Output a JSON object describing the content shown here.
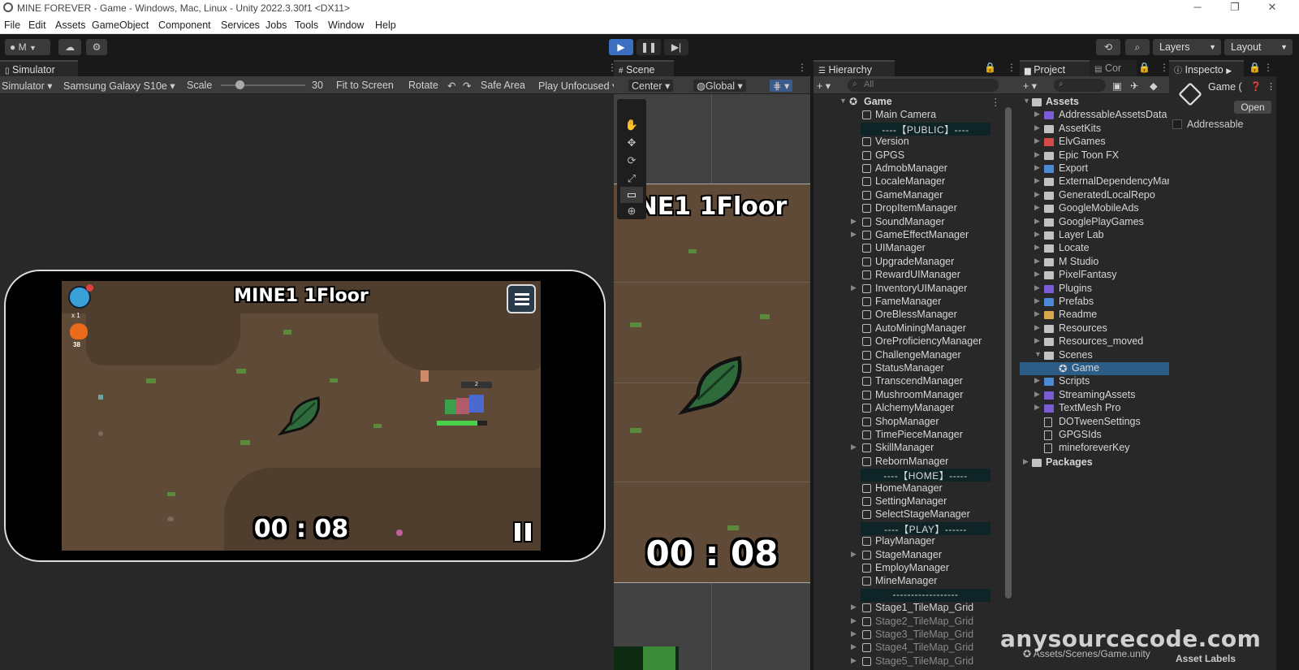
{
  "window": {
    "title": "MINE  FOREVER - Game - Windows, Mac, Linux - Unity 2022.3.30f1 <DX11>",
    "minimize": "─",
    "restore": "❐",
    "close": "✕"
  },
  "menu": [
    "File",
    "Edit",
    "Assets",
    "GameObject",
    "Component",
    "Services",
    "Jobs",
    "Tools",
    "Window",
    "Help"
  ],
  "toolbar": {
    "account_label": "M",
    "layers_label": "Layers",
    "layout_label": "Layout"
  },
  "simulator": {
    "tab_label": "Simulator",
    "mode": "Simulator",
    "device": "Samsung Galaxy S10e",
    "scale_label": "Scale",
    "scale_value": "30",
    "scale_fraction": 0.22,
    "fit_label": "Fit to Screen",
    "rotate_label": "Rotate",
    "safe_area_label": "Safe Area",
    "play_mode": "Play Unfocused",
    "game": {
      "title": "MINE1  1Floor",
      "timer": "00 : 08",
      "gem_count": "x 1",
      "fire_count": "38",
      "player_badge": "2"
    }
  },
  "scene": {
    "tab_label": "Scene",
    "pivot_label": "Center",
    "space_label": "Global",
    "game_title": "NE1  1Floor",
    "timer": "00 : 08"
  },
  "hierarchy": {
    "tab_label": "Hierarchy",
    "search_placeholder": "All",
    "root": "Game",
    "items": [
      {
        "label": "Main Camera",
        "type": "obj",
        "expandable": false
      },
      {
        "label": "----【PUBLIC】----",
        "type": "sep"
      },
      {
        "label": "Version",
        "type": "obj",
        "expandable": false
      },
      {
        "label": "GPGS",
        "type": "obj",
        "expandable": false
      },
      {
        "label": "AdmobManager",
        "type": "obj",
        "expandable": false
      },
      {
        "label": "LocaleManager",
        "type": "obj",
        "expandable": false
      },
      {
        "label": "GameManager",
        "type": "obj",
        "expandable": false
      },
      {
        "label": "DropItemManager",
        "type": "obj",
        "expandable": false
      },
      {
        "label": "SoundManager",
        "type": "obj",
        "expandable": true
      },
      {
        "label": "GameEffectManager",
        "type": "obj",
        "expandable": true
      },
      {
        "label": "UIManager",
        "type": "obj",
        "expandable": false
      },
      {
        "label": "UpgradeManager",
        "type": "obj",
        "expandable": false
      },
      {
        "label": "RewardUIManager",
        "type": "obj",
        "expandable": false
      },
      {
        "label": "InventoryUIManager",
        "type": "obj",
        "expandable": true
      },
      {
        "label": "FameManager",
        "type": "obj",
        "expandable": false
      },
      {
        "label": "OreBlessManager",
        "type": "obj",
        "expandable": false
      },
      {
        "label": "AutoMiningManager",
        "type": "obj",
        "expandable": false
      },
      {
        "label": "OreProficiencyManager",
        "type": "obj",
        "expandable": false
      },
      {
        "label": "ChallengeManager",
        "type": "obj",
        "expandable": false
      },
      {
        "label": "StatusManager",
        "type": "obj",
        "expandable": false
      },
      {
        "label": "TranscendManager",
        "type": "obj",
        "expandable": false
      },
      {
        "label": "MushroomManager",
        "type": "obj",
        "expandable": false
      },
      {
        "label": "AlchemyManager",
        "type": "obj",
        "expandable": false
      },
      {
        "label": "ShopManager",
        "type": "obj",
        "expandable": false
      },
      {
        "label": "TimePieceManager",
        "type": "obj",
        "expandable": false
      },
      {
        "label": "SkillManager",
        "type": "obj",
        "expandable": true
      },
      {
        "label": "RebornManager",
        "type": "obj",
        "expandable": false
      },
      {
        "label": "----【HOME】-----",
        "type": "sep"
      },
      {
        "label": "HomeManager",
        "type": "obj",
        "expandable": false
      },
      {
        "label": "SettingManager",
        "type": "obj",
        "expandable": false
      },
      {
        "label": "SelectStageManager",
        "type": "obj",
        "expandable": false
      },
      {
        "label": "----【PLAY】------",
        "type": "sep"
      },
      {
        "label": "PlayManager",
        "type": "obj",
        "expandable": false
      },
      {
        "label": "StageManager",
        "type": "obj",
        "expandable": true
      },
      {
        "label": "EmployManager",
        "type": "obj",
        "expandable": false
      },
      {
        "label": "MineManager",
        "type": "obj",
        "expandable": false
      },
      {
        "label": "------------------",
        "type": "sep"
      },
      {
        "label": "Stage1_TileMap_Grid",
        "type": "obj",
        "expandable": true
      },
      {
        "label": "Stage2_TileMap_Grid",
        "type": "dim",
        "expandable": true
      },
      {
        "label": "Stage3_TileMap_Grid",
        "type": "dim",
        "expandable": true
      },
      {
        "label": "Stage4_TileMap_Grid",
        "type": "dim",
        "expandable": true
      },
      {
        "label": "Stage5_TileMap_Grid",
        "type": "dim",
        "expandable": true
      }
    ]
  },
  "project": {
    "tab_label": "Project",
    "console_tab_label": "Cor",
    "root": "Assets",
    "items": [
      {
        "label": "AddressableAssetsData",
        "color": "#7b5cd6"
      },
      {
        "label": "AssetKits",
        "color": "#c2c2c2"
      },
      {
        "label": "ElvGames",
        "color": "#d64a4a"
      },
      {
        "label": "Epic Toon FX",
        "color": "#c2c2c2"
      },
      {
        "label": "Export",
        "color": "#4a8ad6"
      },
      {
        "label": "ExternalDependencyManager",
        "color": "#c2c2c2"
      },
      {
        "label": "GeneratedLocalRepo",
        "color": "#c2c2c2"
      },
      {
        "label": "GoogleMobileAds",
        "color": "#c2c2c2"
      },
      {
        "label": "GooglePlayGames",
        "color": "#c2c2c2"
      },
      {
        "label": "Layer Lab",
        "color": "#c2c2c2"
      },
      {
        "label": "Locate",
        "color": "#c2c2c2"
      },
      {
        "label": "M Studio",
        "color": "#c2c2c2"
      },
      {
        "label": "PixelFantasy",
        "color": "#c2c2c2"
      },
      {
        "label": "Plugins",
        "color": "#7b5cd6"
      },
      {
        "label": "Prefabs",
        "color": "#4a8ad6"
      },
      {
        "label": "Readme",
        "color": "#d6a84a"
      },
      {
        "label": "Resources",
        "color": "#c2c2c2"
      },
      {
        "label": "Resources_moved",
        "color": "#c2c2c2"
      },
      {
        "label": "Scenes",
        "color": "#c2c2c2"
      },
      {
        "label": "Game",
        "color": "scene"
      },
      {
        "label": "Scripts",
        "color": "#4a8ad6"
      },
      {
        "label": "StreamingAssets",
        "color": "#7b5cd6"
      },
      {
        "label": "TextMesh Pro",
        "color": "#7b5cd6"
      },
      {
        "label": "DOTweenSettings",
        "color": "file"
      },
      {
        "label": "GPGSIds",
        "color": "file"
      },
      {
        "label": "mineforeverKey",
        "color": "file"
      }
    ],
    "packages": "Packages",
    "footer_path": "Assets/Scenes/Game.unity"
  },
  "inspector": {
    "tab_label": "Inspecto",
    "object_name": "Game (",
    "open_label": "Open",
    "addressable_label": "Addressable",
    "asset_labels": "Asset Labels"
  },
  "watermark": "anysourcecode.com",
  "colors": {
    "accent_play": "#3c6fc2",
    "ground": "#5e4a37",
    "selection": "#2c5d87"
  }
}
